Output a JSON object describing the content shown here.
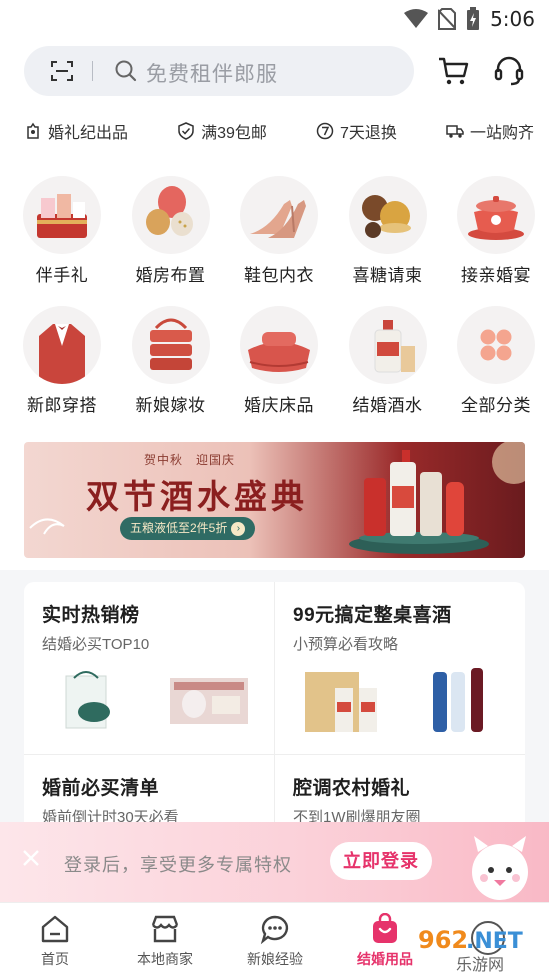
{
  "status_bar": {
    "time": "5:06"
  },
  "search": {
    "placeholder": "免费租伴郎服"
  },
  "promises": [
    {
      "icon": "wedding-souvenir-icon",
      "label": "婚礼纪出品"
    },
    {
      "icon": "shield-check-icon",
      "label": "满39包邮"
    },
    {
      "icon": "seven-day-return-icon",
      "label": "7天退换"
    },
    {
      "icon": "truck-icon",
      "label": "一站购齐"
    }
  ],
  "categories": [
    [
      {
        "label": "伴手礼",
        "icon": "gift-box-icon"
      },
      {
        "label": "婚房布置",
        "icon": "balloons-icon"
      },
      {
        "label": "鞋包内衣",
        "icon": "high-heels-icon"
      },
      {
        "label": "喜糖请柬",
        "icon": "candy-icon"
      },
      {
        "label": "接亲婚宴",
        "icon": "tea-cup-icon"
      }
    ],
    [
      {
        "label": "新郎穿搭",
        "icon": "suit-icon"
      },
      {
        "label": "新娘嫁妆",
        "icon": "dowry-basket-icon"
      },
      {
        "label": "婚庆床品",
        "icon": "bedding-icon"
      },
      {
        "label": "结婚酒水",
        "icon": "liquor-bottle-icon"
      },
      {
        "label": "全部分类",
        "icon": "all-categories-icon"
      }
    ]
  ],
  "banner": {
    "subtitle": "贺中秋　迎国庆",
    "title": "双节酒水盛典",
    "pill": "五粮液低至2件5折"
  },
  "feature_cards": [
    {
      "title": "实时热销榜",
      "subtitle": "结婚必买TOP10"
    },
    {
      "title": "99元搞定整桌喜酒",
      "subtitle": "小预算必看攻略"
    },
    {
      "title": "婚前必买清单",
      "subtitle": "婚前倒计时30天必看"
    },
    {
      "title": "腔调农村婚礼",
      "subtitle": "不到1W刷爆朋友圈"
    }
  ],
  "login_bar": {
    "text": "登录后，享受更多专属特权",
    "button": "立即登录"
  },
  "bottom_nav": [
    {
      "label": "首页",
      "icon": "home-icon",
      "active": false
    },
    {
      "label": "本地商家",
      "icon": "store-icon",
      "active": false
    },
    {
      "label": "新娘经验",
      "icon": "chat-bubble-icon",
      "active": false
    },
    {
      "label": "结婚用品",
      "icon": "shopping-bag-icon",
      "active": true
    }
  ],
  "watermark": {
    "text": "962.NET",
    "sub": "乐游网"
  },
  "colors": {
    "accent": "#e6336b",
    "banner_red": "#8b1f1f",
    "pill_green": "#2f6b64"
  }
}
